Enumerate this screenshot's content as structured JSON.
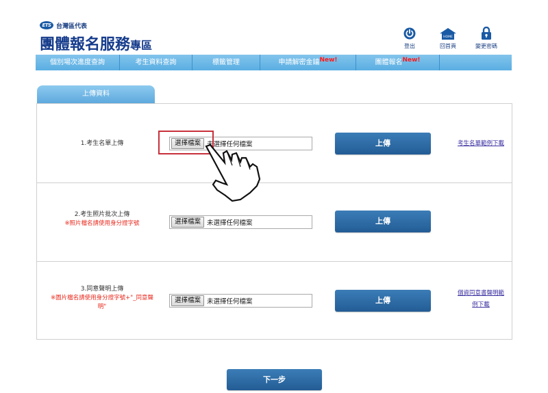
{
  "header": {
    "logo_text": "ETS",
    "org_label": "台灣區代表",
    "title_main": "團體報名服務",
    "title_suffix": "專區",
    "actions": [
      {
        "label": "登出",
        "icon": "power-icon"
      },
      {
        "label": "回首頁",
        "icon": "home-icon",
        "icon_text": "HOME"
      },
      {
        "label": "變更密碼",
        "icon": "lock-icon"
      }
    ]
  },
  "nav": {
    "items": [
      {
        "label": "個別場次進度查詢"
      },
      {
        "label": "考生資料查詢"
      },
      {
        "label": "標籤管理"
      },
      {
        "label": "申請解密金鑰",
        "badge": "New!"
      },
      {
        "label": "團體報名",
        "badge": "New!"
      }
    ]
  },
  "tab": {
    "label": "上傳資料"
  },
  "rows": [
    {
      "label": "1.考生名單上傳",
      "note": "",
      "file_button": "選擇檔案",
      "file_status": "未選擇任何檔案",
      "upload_label": "上傳",
      "link": "考生名單範例下載"
    },
    {
      "label": "2.考生照片批次上傳",
      "note": "※照片檔名請使用身分證字號",
      "file_button": "選擇檔案",
      "file_status": "未選擇任何檔案",
      "upload_label": "上傳",
      "link": ""
    },
    {
      "label": "3.同意聲明上傳",
      "note_line1": "※圖片檔名請使用身分證字號+\"_同意聲",
      "note_line2": "明\"",
      "file_button": "選擇檔案",
      "file_status": "未選擇任何檔案",
      "upload_label": "上傳",
      "link_line1": "個資同意書聲明範",
      "link_line2": "例下載"
    }
  ],
  "next_label": "下一步",
  "colors": {
    "brand_blue": "#163c8c",
    "nav_blue": "#5aaee2",
    "button_blue": "#235c95",
    "note_red": "#e8271b",
    "highlight_red": "#c8303a"
  }
}
